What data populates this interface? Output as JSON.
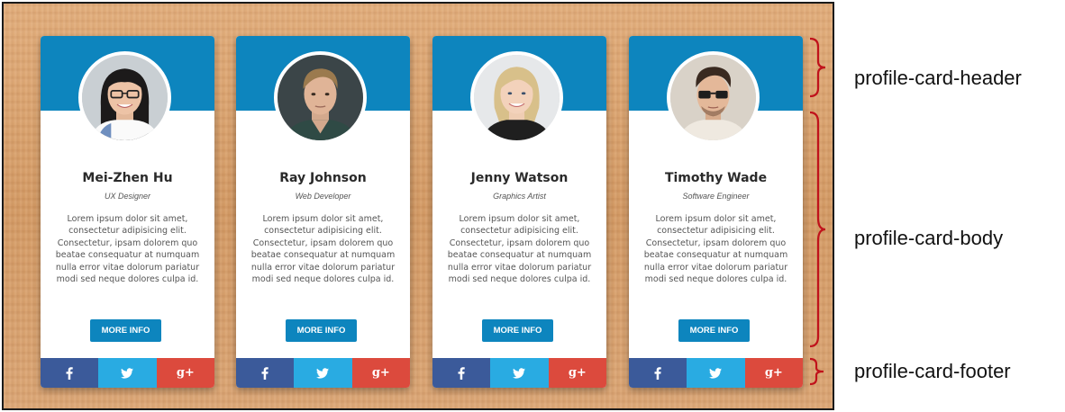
{
  "cards": [
    {
      "name": "Mei-Zhen Hu",
      "role": "UX Designer",
      "description": "Lorem ipsum dolor sit amet, consectetur adipisicing elit. Consectetur, ipsam dolorem quo beatae consequatur at numquam nulla error vitae dolorum pariatur modi sed neque dolores culpa id.",
      "button": "MORE INFO"
    },
    {
      "name": "Ray Johnson",
      "role": "Web Developer",
      "description": "Lorem ipsum dolor sit amet, consectetur adipisicing elit. Consectetur, ipsam dolorem quo beatae consequatur at numquam nulla error vitae dolorum pariatur modi sed neque dolores culpa id.",
      "button": "MORE INFO"
    },
    {
      "name": "Jenny Watson",
      "role": "Graphics Artist",
      "description": "Lorem ipsum dolor sit amet, consectetur adipisicing elit. Consectetur, ipsam dolorem quo beatae consequatur at numquam nulla error vitae dolorum pariatur modi sed neque dolores culpa id.",
      "button": "MORE INFO"
    },
    {
      "name": "Timothy Wade",
      "role": "Software Engineer",
      "description": "Lorem ipsum dolor sit amet, consectetur adipisicing elit. Consectetur, ipsam dolorem quo beatae consequatur at numquam nulla error vitae dolorum pariatur modi sed neque dolores culpa id.",
      "button": "MORE INFO"
    }
  ],
  "social": {
    "facebook_icon": "facebook-icon",
    "twitter_icon": "twitter-icon",
    "googleplus_icon": "google-plus-icon",
    "googleplus_glyph": "g+"
  },
  "annotations": {
    "header": "profile-card-header",
    "body": "profile-card-body",
    "footer": "profile-card-footer"
  },
  "colors": {
    "header_blue": "#0d85be",
    "facebook": "#3b5a9a",
    "twitter": "#29abe2",
    "googleplus": "#dc4a3d",
    "brace_red": "#c0121b",
    "wood": "#d8a06c"
  }
}
